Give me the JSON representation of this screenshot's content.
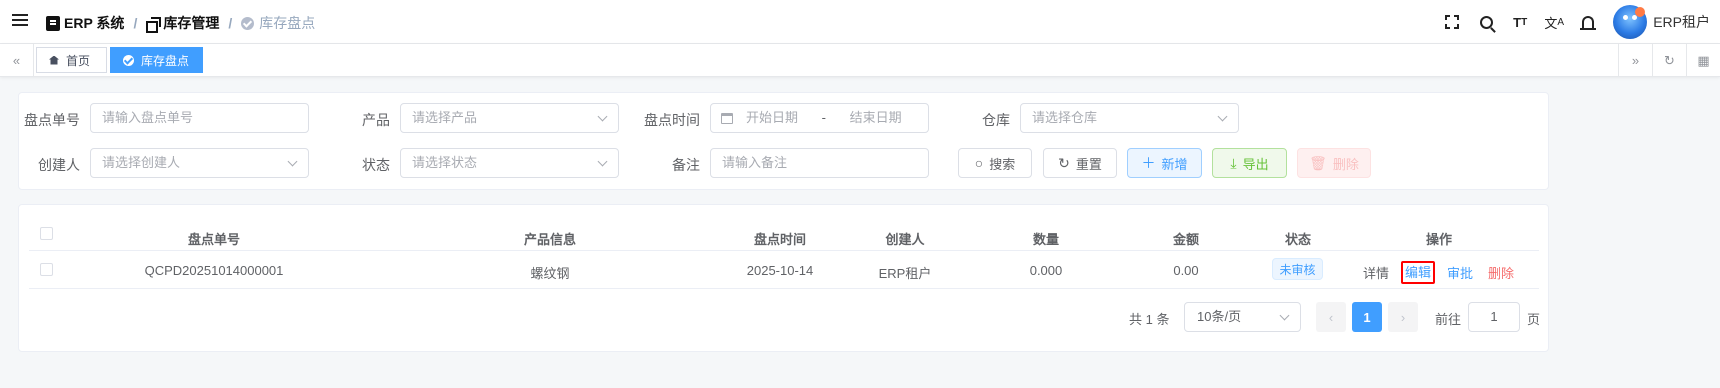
{
  "header": {
    "brand": "ERP 系统",
    "breadcrumb_level1": "库存管理",
    "breadcrumb_level2": "库存盘点",
    "user_name": "ERP租户"
  },
  "tabs": [
    {
      "label": "首页"
    },
    {
      "label": "库存盘点"
    }
  ],
  "search": {
    "fields": [
      {
        "label": "盘点单号",
        "placeholder": "请输入盘点单号"
      },
      {
        "label": "产品",
        "placeholder": "请选择产品"
      },
      {
        "label": "盘点时间",
        "start_placeholder": "开始日期",
        "separator": "-",
        "end_placeholder": "结束日期"
      },
      {
        "label": "仓库",
        "placeholder": "请选择仓库"
      },
      {
        "label": "创建人",
        "placeholder": "请选择创建人"
      },
      {
        "label": "状态",
        "placeholder": "请选择状态"
      },
      {
        "label": "备注",
        "placeholder": "请输入备注"
      }
    ],
    "buttons": {
      "search": "搜索",
      "reset": "重置",
      "add": "新增",
      "export": "导出",
      "delete": "删除"
    }
  },
  "table": {
    "columns": [
      "盘点单号",
      "产品信息",
      "盘点时间",
      "创建人",
      "数量",
      "金额",
      "状态",
      "操作"
    ],
    "rows": [
      {
        "no": "QCPD20251014000001",
        "product": "螺纹钢",
        "time": "2025-10-14",
        "creator": "ERP租户",
        "quantity": "0.000",
        "amount": "0.00",
        "status": "未审核",
        "actions": {
          "detail": "详情",
          "edit": "编辑",
          "audit": "审批",
          "delete": "删除"
        }
      }
    ]
  },
  "pagination": {
    "total_text": "共 1 条",
    "page_size": "10条/页",
    "current_page": "1",
    "goto_prefix": "前往",
    "goto_value": "1",
    "goto_suffix": "页"
  },
  "colors": {
    "primary": "#409eff",
    "success": "#67c23a",
    "danger": "#f56c6c",
    "highlight_box": "#ff0000"
  }
}
